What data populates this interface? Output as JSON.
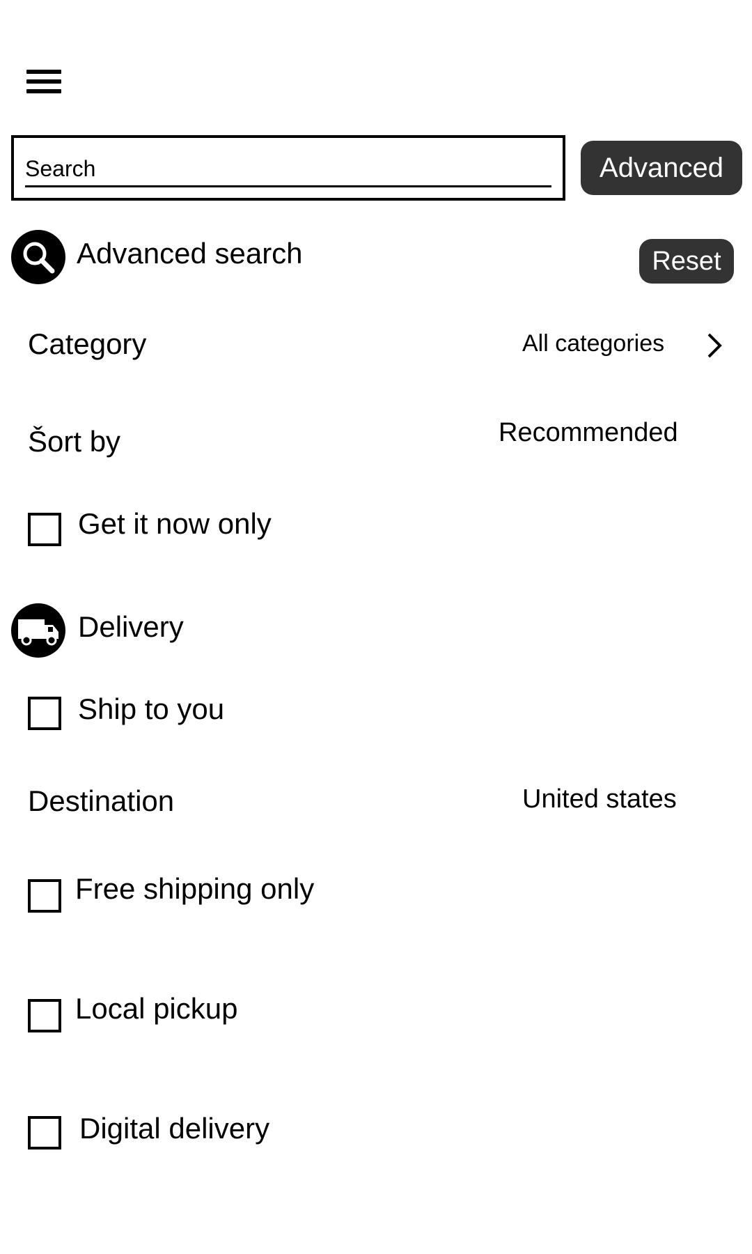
{
  "header": {
    "menu_icon": "hamburger-menu-icon"
  },
  "search": {
    "placeholder": "Search",
    "value": "",
    "advanced_label": "Advanced"
  },
  "advanced_search": {
    "icon": "magnifier-icon",
    "title": "Advanced search",
    "reset_label": "Reset"
  },
  "filters": {
    "category": {
      "label": "Category",
      "value": "All categories",
      "chevron_icon": "chevron-right-icon"
    },
    "sort_by": {
      "label": "Šort by",
      "value": "Recommended"
    },
    "get_it_now": {
      "label": "Get it now only",
      "checked": false
    }
  },
  "delivery": {
    "icon": "truck-icon",
    "title": "Delivery",
    "ship_to_you": {
      "label": "Ship to you",
      "checked": false
    },
    "destination": {
      "label": "Destination",
      "value": "United states"
    },
    "free_shipping": {
      "label": "Free shipping only",
      "checked": false
    },
    "local_pickup": {
      "label": "Local pickup",
      "checked": false
    },
    "digital_delivery": {
      "label": "Digital delivery",
      "checked": false
    }
  }
}
